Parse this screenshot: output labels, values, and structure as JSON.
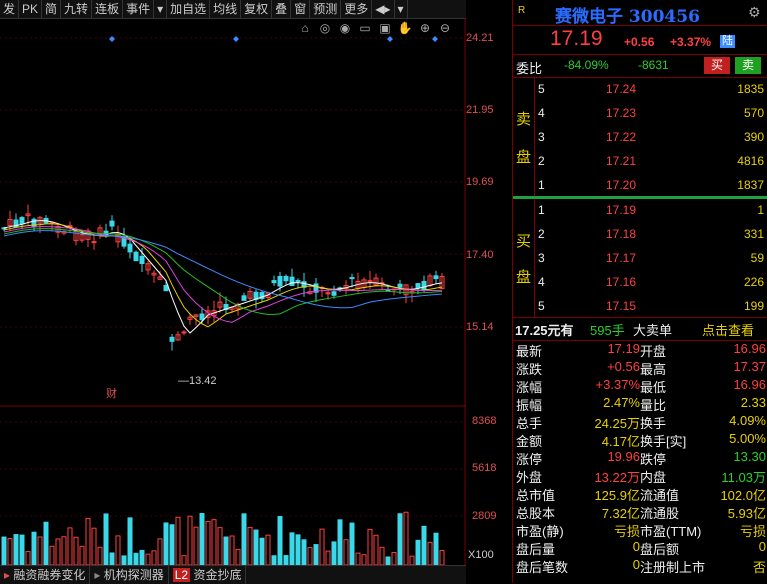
{
  "toolbar": {
    "items": [
      "发",
      "PK",
      "简",
      "九转",
      "连板",
      "事件",
      "▾",
      "加自选",
      "均线",
      "复权",
      "叠",
      "窗",
      "预测",
      "更多",
      "◀▸",
      "▾"
    ]
  },
  "chart_icons": [
    "mouse-icon",
    "target-icon",
    "eye-icon",
    "screen-icon",
    "save-icon",
    "hand-icon",
    "zoom-in-icon",
    "zoom-out-icon"
  ],
  "price_axis": [
    "24.21",
    "21.95",
    "19.69",
    "17.40",
    "15.14"
  ],
  "volume_axis": [
    "8368",
    "5618",
    "2809",
    "X100"
  ],
  "low_marker": "13.42",
  "fin_marker": "财",
  "bottom_tabs": [
    "融资融券变化",
    "机构探测器",
    "L2",
    "资金抄底"
  ],
  "stock": {
    "r_label": "R",
    "name": "赛微电子",
    "code": "300456",
    "price": "17.19",
    "change": "+0.56",
    "change_pct": "+3.37%",
    "badge": "陆",
    "weibi_label": "委比",
    "weibi_pct": "-84.09%",
    "weibi_val": "-8631",
    "buy_btn": "买",
    "sell_btn": "卖"
  },
  "sell_side_label": [
    "卖",
    "盘"
  ],
  "buy_side_label": [
    "买",
    "盘"
  ],
  "asks": [
    {
      "level": "5",
      "price": "17.24",
      "vol": "1835"
    },
    {
      "level": "4",
      "price": "17.23",
      "vol": "570"
    },
    {
      "level": "3",
      "price": "17.22",
      "vol": "390"
    },
    {
      "level": "2",
      "price": "17.21",
      "vol": "4816"
    },
    {
      "level": "1",
      "price": "17.20",
      "vol": "1837"
    }
  ],
  "bids": [
    {
      "level": "1",
      "price": "17.19",
      "vol": "1"
    },
    {
      "level": "2",
      "price": "17.18",
      "vol": "331"
    },
    {
      "level": "3",
      "price": "17.17",
      "vol": "59"
    },
    {
      "level": "4",
      "price": "17.16",
      "vol": "226"
    },
    {
      "level": "5",
      "price": "17.15",
      "vol": "199"
    }
  ],
  "big_order": {
    "price": "17.25元有",
    "qty": "595手",
    "label": "大卖单",
    "link": "点击查看"
  },
  "quote": [
    [
      "最新",
      "17.19",
      "开盘",
      "16.96"
    ],
    [
      "涨跌",
      "+0.56",
      "最高",
      "17.37"
    ],
    [
      "涨幅",
      "+3.37%",
      "最低",
      "16.96"
    ],
    [
      "振幅",
      "2.47%",
      "量比",
      "2.33"
    ],
    [
      "总手",
      "24.25万",
      "换手",
      "4.09%"
    ],
    [
      "金额",
      "4.17亿",
      "换手[实]",
      "5.00%"
    ],
    [
      "涨停",
      "19.96",
      "跌停",
      "13.30"
    ],
    [
      "外盘",
      "13.22万",
      "内盘",
      "11.03万"
    ],
    [
      "总市值",
      "125.9亿",
      "流通值",
      "102.0亿"
    ],
    [
      "总股本",
      "7.32亿",
      "流通股",
      "5.93亿"
    ],
    [
      "市盈(静)",
      "亏损",
      "市盈(TTM)",
      "亏损"
    ],
    [
      "盘后量",
      "0",
      "盘后额",
      "0"
    ],
    [
      "盘后笔数",
      "0",
      "注册制上市",
      "否"
    ]
  ],
  "colors": {
    "up": "#ff4040",
    "down": "#2ad02a",
    "ma5": "#ffffff",
    "ma10": "#e8d000",
    "ma20": "#e040e0",
    "ma60": "#20c020",
    "ma120": "#3a8cff"
  }
}
